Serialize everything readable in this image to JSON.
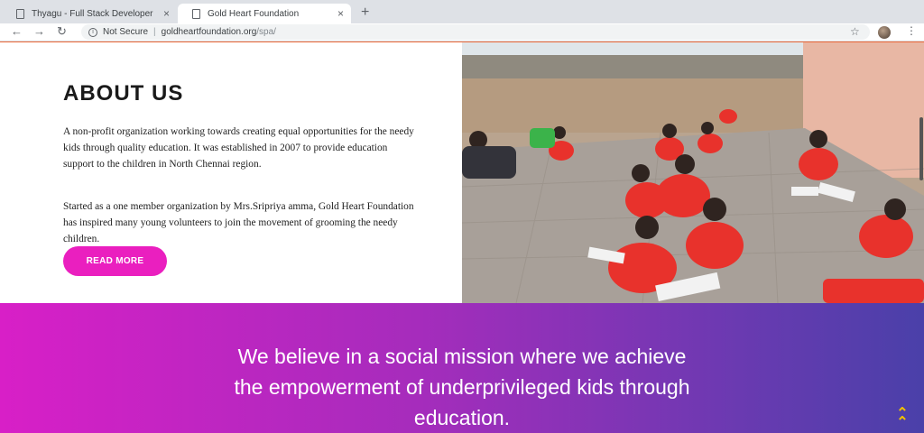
{
  "browser": {
    "tabs": [
      {
        "title": "Thyagu - Full Stack Developer",
        "close": "×"
      },
      {
        "title": "Gold Heart Foundation",
        "close": "×"
      }
    ],
    "new_tab": "+",
    "nav": {
      "back": "←",
      "forward": "→",
      "reload": "↻"
    },
    "security": "Not Secure",
    "url_domain": "goldheartfoundation.org",
    "url_path": "/spa/",
    "bookmark_icon": "☆",
    "menu_icon": "⋮"
  },
  "about": {
    "heading": "ABOUT US",
    "paragraph1": "A non-profit organization working towards creating equal opportunities for the needy kids through quality education. It was established in 2007 to provide education support to the children in North Chennai region.",
    "paragraph2": "Started as a one member organization by Mrs.Sripriya amma, Gold Heart Foundation has inspired many young volunteers to join the movement of grooming the needy children.",
    "read_more": "READ MORE"
  },
  "mission": {
    "line1": "We believe in a social mission where we achieve",
    "line2": "the empowerment of underprivileged kids through",
    "line3": "education.",
    "scroll_top_icon": "⌃"
  },
  "colors": {
    "accent_pink": "#ea1fbf",
    "gradient_start": "#d81fc7",
    "gradient_end": "#4a40a9",
    "scroll_top": "#f2c200"
  }
}
